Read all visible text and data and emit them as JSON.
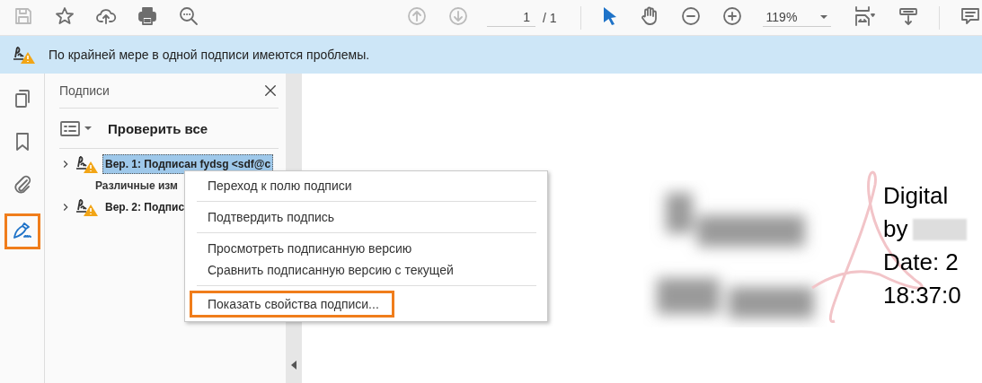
{
  "toolbar": {
    "page_input": "1",
    "page_total": "/ 1",
    "zoom": "119%"
  },
  "banner": {
    "message": "По крайней мере в одной подписи имеются проблемы."
  },
  "rail": [
    {
      "kind": "pages",
      "selected": false,
      "highlighted": false
    },
    {
      "kind": "bookmarks",
      "selected": false,
      "highlighted": false
    },
    {
      "kind": "attachments",
      "selected": false,
      "highlighted": false
    },
    {
      "kind": "signatures",
      "selected": true,
      "highlighted": true
    }
  ],
  "panel": {
    "title": "Подписи",
    "verify_all": "Проверить все",
    "signatures": [
      {
        "label": "Вер. 1: Подписан fydsg <sdf@c",
        "detail": "Различные изм",
        "selected": true,
        "expanded": false
      },
      {
        "label": "Вер. 2: Подпис",
        "selected": false,
        "expanded": false
      }
    ]
  },
  "context_menu": {
    "groups": [
      [
        {
          "label": "Переход к полю подписи",
          "highlighted": false
        }
      ],
      [
        {
          "label": "Подтвердить подпись",
          "highlighted": false
        }
      ],
      [
        {
          "label": "Просмотреть подписанную версию",
          "highlighted": false
        },
        {
          "label": "Сравнить подписанную версию с текущей",
          "highlighted": false
        }
      ],
      [
        {
          "label": "Показать свойства подписи...",
          "highlighted": true
        }
      ]
    ]
  },
  "document": {
    "signature_lines": [
      "Digital",
      "by",
      "Date: 2",
      "18:37:0"
    ]
  }
}
